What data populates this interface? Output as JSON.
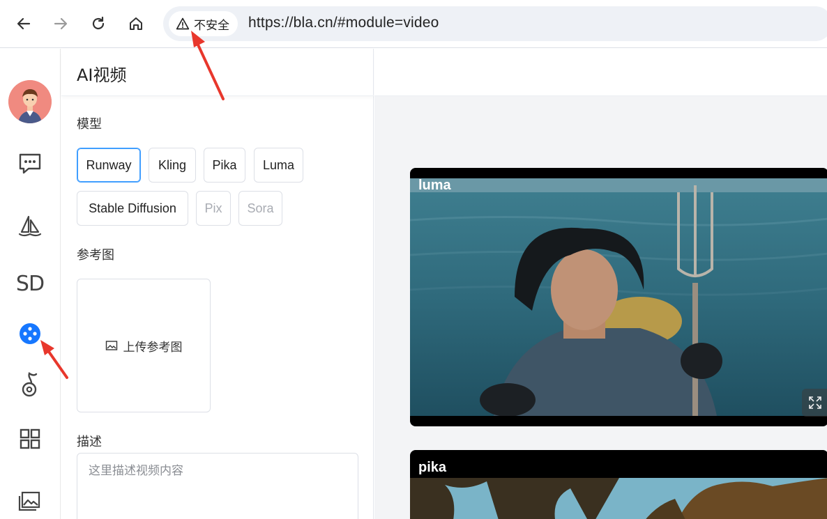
{
  "browser": {
    "security_label": "不安全",
    "url": "https://bla.cn/#module=video"
  },
  "rail": {
    "items": [
      "avatar",
      "chat-icon",
      "sailboat-icon",
      "SD",
      "video-icon",
      "music-icon",
      "grid-icon",
      "gallery-icon"
    ],
    "sd_label": "SD",
    "active_color": "#1677ff"
  },
  "panel": {
    "title": "AI视频",
    "model_label": "模型",
    "models": [
      {
        "label": "Runway",
        "state": "selected"
      },
      {
        "label": "Kling",
        "state": "normal"
      },
      {
        "label": "Pika",
        "state": "normal"
      },
      {
        "label": "Luma",
        "state": "normal"
      },
      {
        "label": "Stable Diffusion",
        "state": "normal"
      },
      {
        "label": "Pix",
        "state": "disabled"
      },
      {
        "label": "Sora",
        "state": "disabled"
      }
    ],
    "reference_label": "参考图",
    "upload_label": "上传参考图",
    "description_label": "描述",
    "description_placeholder": "这里描述视频内容"
  },
  "videos": [
    {
      "label": "luma"
    },
    {
      "label": "pika"
    }
  ],
  "colors": {
    "accent": "#409eff",
    "annotation": "#e8372c"
  }
}
